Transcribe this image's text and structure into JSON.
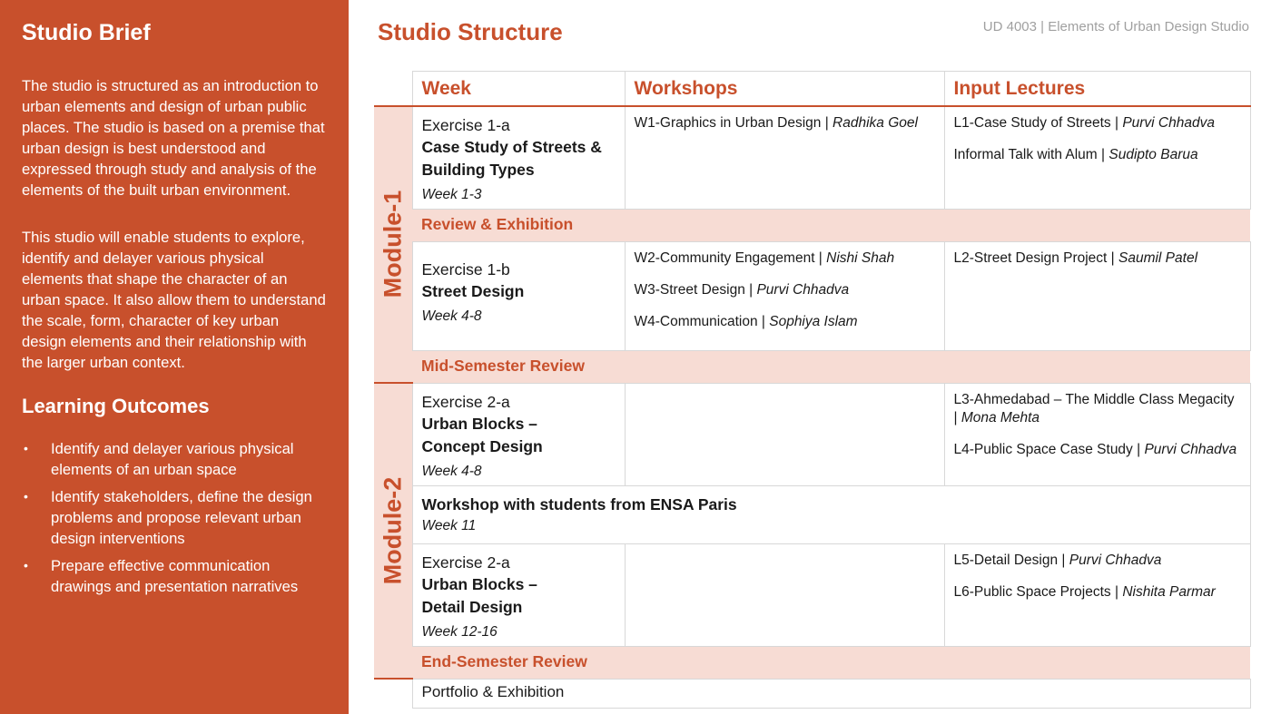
{
  "left": {
    "title": "Studio Brief",
    "para1": "The studio is structured as an introduction to urban elements and design of urban public places. The studio is based on a premise that urban design is best understood and expressed through study and analysis of the elements of the built urban environment.",
    "para2": "This studio will enable students to explore, identify and delayer various physical elements that shape the character of an urban space. It also allow them to understand the scale, form, character of key urban design elements and their relationship with the larger urban context.",
    "outcomes_title": "Learning Outcomes",
    "bullet": "•",
    "outcomes": [
      "Identify and delayer various physical elements of an urban space",
      "Identify stakeholders, define the design problems and propose relevant urban design interventions",
      "Prepare effective communication drawings and presentation narratives"
    ]
  },
  "header": {
    "title": "Studio Structure",
    "course": "UD 4003 | Elements of Urban Design Studio"
  },
  "table": {
    "columns": [
      "Week",
      "Workshops",
      "Input Lectures"
    ],
    "modules": [
      "Module-1",
      "Module-2"
    ],
    "ex1a": {
      "name": "Exercise 1-a",
      "title1": "Case Study of Streets &",
      "title2": "Building Types",
      "week": "Week 1-3",
      "workshops": [
        {
          "text": "W1-Graphics in Urban Design | ",
          "person": "Radhika Goel"
        }
      ],
      "lectures": [
        {
          "text": "L1-Case Study of Streets | ",
          "person": "Purvi Chhadva"
        },
        {
          "text": "Informal Talk with Alum | ",
          "person": "Sudipto Barua"
        }
      ]
    },
    "review1": "Review & Exhibition",
    "ex1b": {
      "name": "Exercise 1-b",
      "title1": "Street Design",
      "week": "Week 4-8",
      "workshops": [
        {
          "text": "W2-Community Engagement | ",
          "person": "Nishi Shah"
        },
        {
          "text": "W3-Street Design | ",
          "person": "Purvi Chhadva"
        },
        {
          "text": "W4-Communication | ",
          "person": "Sophiya Islam"
        }
      ],
      "lectures": [
        {
          "text": "L2-Street Design Project | ",
          "person": "Saumil Patel"
        }
      ]
    },
    "review2": "Mid-Semester Review",
    "ex2a": {
      "name": "Exercise 2-a",
      "title1": "Urban Blocks –",
      "title2": "Concept Design",
      "week": "Week 4-8",
      "lectures": [
        {
          "text": "L3-Ahmedabad – The Middle Class Megacity | ",
          "person": "Mona Mehta"
        },
        {
          "text": "L4-Public Space Case Study | ",
          "person": "Purvi Chhadva"
        }
      ]
    },
    "workshop_ensa": {
      "title": "Workshop with students from ENSA Paris",
      "week": "Week 11"
    },
    "ex2b": {
      "name": "Exercise 2-a",
      "title1": "Urban Blocks –",
      "title2": "Detail Design",
      "week": "Week 12-16",
      "lectures": [
        {
          "text": "L5-Detail Design | ",
          "person": "Purvi Chhadva"
        },
        {
          "text": "L6-Public Space Projects | ",
          "person": "Nishita Parmar"
        }
      ]
    },
    "review3": "End-Semester Review",
    "portfolio": "Portfolio & Exhibition"
  }
}
